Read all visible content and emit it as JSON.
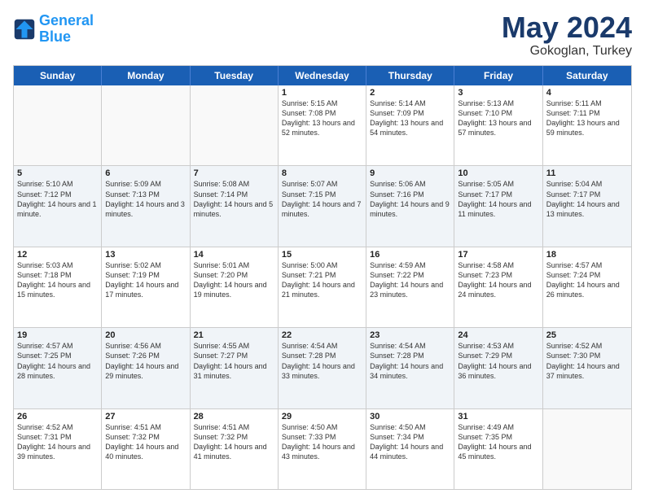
{
  "header": {
    "logo_general": "General",
    "logo_blue": "Blue",
    "month_title": "May 2024",
    "location": "Gokoglan, Turkey"
  },
  "weekdays": [
    "Sunday",
    "Monday",
    "Tuesday",
    "Wednesday",
    "Thursday",
    "Friday",
    "Saturday"
  ],
  "rows": [
    {
      "alt": false,
      "cells": [
        {
          "date": "",
          "content": ""
        },
        {
          "date": "",
          "content": ""
        },
        {
          "date": "",
          "content": ""
        },
        {
          "date": "1",
          "content": "Sunrise: 5:15 AM\nSunset: 7:08 PM\nDaylight: 13 hours and 52 minutes."
        },
        {
          "date": "2",
          "content": "Sunrise: 5:14 AM\nSunset: 7:09 PM\nDaylight: 13 hours and 54 minutes."
        },
        {
          "date": "3",
          "content": "Sunrise: 5:13 AM\nSunset: 7:10 PM\nDaylight: 13 hours and 57 minutes."
        },
        {
          "date": "4",
          "content": "Sunrise: 5:11 AM\nSunset: 7:11 PM\nDaylight: 13 hours and 59 minutes."
        }
      ]
    },
    {
      "alt": true,
      "cells": [
        {
          "date": "5",
          "content": "Sunrise: 5:10 AM\nSunset: 7:12 PM\nDaylight: 14 hours and 1 minute."
        },
        {
          "date": "6",
          "content": "Sunrise: 5:09 AM\nSunset: 7:13 PM\nDaylight: 14 hours and 3 minutes."
        },
        {
          "date": "7",
          "content": "Sunrise: 5:08 AM\nSunset: 7:14 PM\nDaylight: 14 hours and 5 minutes."
        },
        {
          "date": "8",
          "content": "Sunrise: 5:07 AM\nSunset: 7:15 PM\nDaylight: 14 hours and 7 minutes."
        },
        {
          "date": "9",
          "content": "Sunrise: 5:06 AM\nSunset: 7:16 PM\nDaylight: 14 hours and 9 minutes."
        },
        {
          "date": "10",
          "content": "Sunrise: 5:05 AM\nSunset: 7:17 PM\nDaylight: 14 hours and 11 minutes."
        },
        {
          "date": "11",
          "content": "Sunrise: 5:04 AM\nSunset: 7:17 PM\nDaylight: 14 hours and 13 minutes."
        }
      ]
    },
    {
      "alt": false,
      "cells": [
        {
          "date": "12",
          "content": "Sunrise: 5:03 AM\nSunset: 7:18 PM\nDaylight: 14 hours and 15 minutes."
        },
        {
          "date": "13",
          "content": "Sunrise: 5:02 AM\nSunset: 7:19 PM\nDaylight: 14 hours and 17 minutes."
        },
        {
          "date": "14",
          "content": "Sunrise: 5:01 AM\nSunset: 7:20 PM\nDaylight: 14 hours and 19 minutes."
        },
        {
          "date": "15",
          "content": "Sunrise: 5:00 AM\nSunset: 7:21 PM\nDaylight: 14 hours and 21 minutes."
        },
        {
          "date": "16",
          "content": "Sunrise: 4:59 AM\nSunset: 7:22 PM\nDaylight: 14 hours and 23 minutes."
        },
        {
          "date": "17",
          "content": "Sunrise: 4:58 AM\nSunset: 7:23 PM\nDaylight: 14 hours and 24 minutes."
        },
        {
          "date": "18",
          "content": "Sunrise: 4:57 AM\nSunset: 7:24 PM\nDaylight: 14 hours and 26 minutes."
        }
      ]
    },
    {
      "alt": true,
      "cells": [
        {
          "date": "19",
          "content": "Sunrise: 4:57 AM\nSunset: 7:25 PM\nDaylight: 14 hours and 28 minutes."
        },
        {
          "date": "20",
          "content": "Sunrise: 4:56 AM\nSunset: 7:26 PM\nDaylight: 14 hours and 29 minutes."
        },
        {
          "date": "21",
          "content": "Sunrise: 4:55 AM\nSunset: 7:27 PM\nDaylight: 14 hours and 31 minutes."
        },
        {
          "date": "22",
          "content": "Sunrise: 4:54 AM\nSunset: 7:28 PM\nDaylight: 14 hours and 33 minutes."
        },
        {
          "date": "23",
          "content": "Sunrise: 4:54 AM\nSunset: 7:28 PM\nDaylight: 14 hours and 34 minutes."
        },
        {
          "date": "24",
          "content": "Sunrise: 4:53 AM\nSunset: 7:29 PM\nDaylight: 14 hours and 36 minutes."
        },
        {
          "date": "25",
          "content": "Sunrise: 4:52 AM\nSunset: 7:30 PM\nDaylight: 14 hours and 37 minutes."
        }
      ]
    },
    {
      "alt": false,
      "cells": [
        {
          "date": "26",
          "content": "Sunrise: 4:52 AM\nSunset: 7:31 PM\nDaylight: 14 hours and 39 minutes."
        },
        {
          "date": "27",
          "content": "Sunrise: 4:51 AM\nSunset: 7:32 PM\nDaylight: 14 hours and 40 minutes."
        },
        {
          "date": "28",
          "content": "Sunrise: 4:51 AM\nSunset: 7:32 PM\nDaylight: 14 hours and 41 minutes."
        },
        {
          "date": "29",
          "content": "Sunrise: 4:50 AM\nSunset: 7:33 PM\nDaylight: 14 hours and 43 minutes."
        },
        {
          "date": "30",
          "content": "Sunrise: 4:50 AM\nSunset: 7:34 PM\nDaylight: 14 hours and 44 minutes."
        },
        {
          "date": "31",
          "content": "Sunrise: 4:49 AM\nSunset: 7:35 PM\nDaylight: 14 hours and 45 minutes."
        },
        {
          "date": "",
          "content": ""
        }
      ]
    }
  ]
}
